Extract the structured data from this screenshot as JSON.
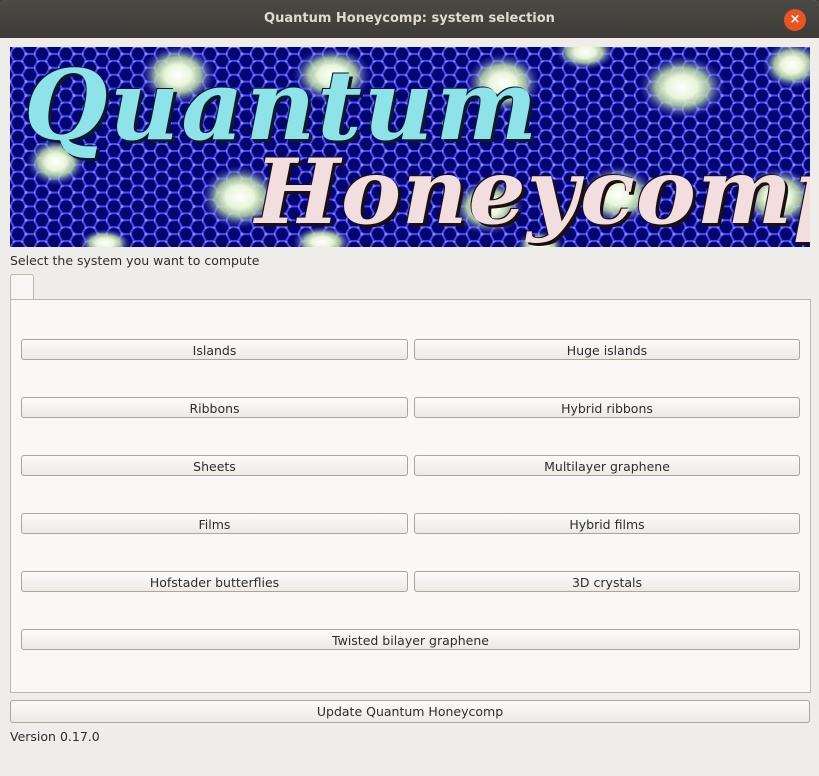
{
  "window": {
    "title": "Quantum Honeycomp: system selection",
    "close_glyph": "×"
  },
  "banner": {
    "word1": "Quantum",
    "word2": "Honeycomp"
  },
  "prompt": "Select the system you want to compute",
  "tab": {
    "label": ""
  },
  "systems": [
    "Islands",
    "Huge islands",
    "Ribbons",
    "Hybrid ribbons",
    "Sheets",
    "Multilayer graphene",
    "Films",
    "Hybrid films",
    "Hofstader butterflies",
    "3D crystals",
    "Twisted bilayer graphene"
  ],
  "update_label": "Update Quantum Honeycomp",
  "version": "Version 0.17.0",
  "colors": {
    "accent": "#e95420",
    "banner_bg": "#0a0a9a",
    "lattice": "#3a3aff"
  }
}
